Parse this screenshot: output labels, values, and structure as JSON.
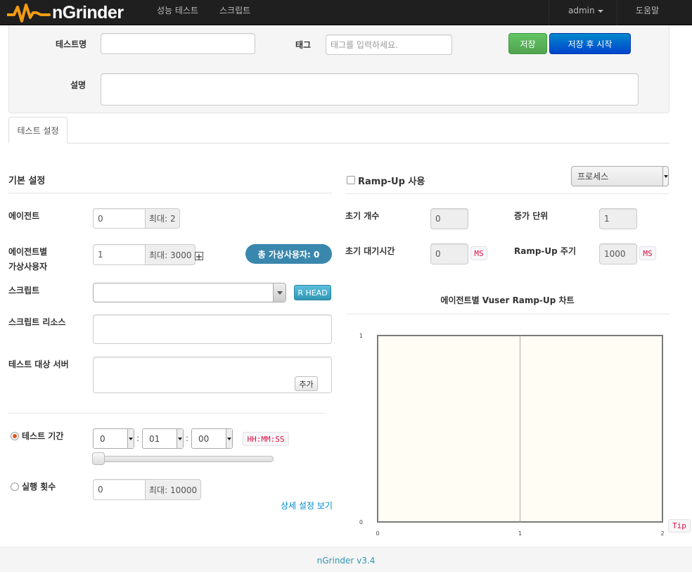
{
  "navbar": {
    "brand": "nGrinder",
    "links": [
      "성능 테스트",
      "스크립트"
    ],
    "user": "admin",
    "help": "도움말"
  },
  "header_form": {
    "test_name_label": "테스트명",
    "test_name_value": "",
    "tag_label": "태그",
    "tag_placeholder": "태그를 입력하세요.",
    "save_label": "저장",
    "save_start_label": "저장 후 시작",
    "description_label": "설명",
    "description_value": ""
  },
  "tabs": [
    "테스트 설정"
  ],
  "basic": {
    "title": "기본 설정",
    "agent_label": "에이전트",
    "agent_value": "0",
    "agent_max": "최대: 2",
    "vuser_label_1": "에이전트별",
    "vuser_label_2": "가상사용자",
    "vuser_value": "1",
    "vuser_max": "최대: 3000",
    "total_vuser": "총 가상사용자: 0",
    "script_label": "스크립트",
    "script_value": "",
    "rhead_label": "R HEAD",
    "resource_label": "스크립트 리소스",
    "target_label": "테스트 대상 서버",
    "add_label": "추가",
    "duration_label": "테스트 기간",
    "duration_h": "0",
    "duration_m": "01",
    "duration_s": "00",
    "duration_format": "HH:MM:SS",
    "duration_selected": true,
    "run_count_label": "실행 횟수",
    "run_count_value": "0",
    "run_count_max": "최대: 10000",
    "advanced_link": "상세 설정 보기"
  },
  "rampup": {
    "enable_label": "Ramp-Up 사용",
    "enabled": false,
    "type_value": "프로세스",
    "initial_count_label": "초기 개수",
    "initial_count_value": "0",
    "increment_label": "증가 단위",
    "increment_value": "1",
    "initial_sleep_label": "초기 대기시간",
    "initial_sleep_value": "0",
    "initial_sleep_unit": "MS",
    "interval_label": "Ramp-Up 주기",
    "interval_value": "1000",
    "interval_unit": "MS",
    "chart_title": "에이전트별 Vuser Ramp-Up 차트",
    "tip_label": "Tip"
  },
  "chart_data": {
    "type": "line",
    "title": "에이전트별 Vuser Ramp-Up 차트",
    "x_ticks": [
      "0",
      "1",
      "2"
    ],
    "y_ticks": [
      "0",
      "1"
    ],
    "xlim": [
      0,
      2
    ],
    "ylim": [
      0,
      1
    ],
    "series": [],
    "grid": true
  },
  "colors": {
    "navbar_bg": "#1f1f1f",
    "brand_orange": "#f39c12",
    "chart_bg": "#fffdf4",
    "pill_bg": "#3a87ad"
  },
  "footer": {
    "version": "nGrinder v3.4"
  }
}
